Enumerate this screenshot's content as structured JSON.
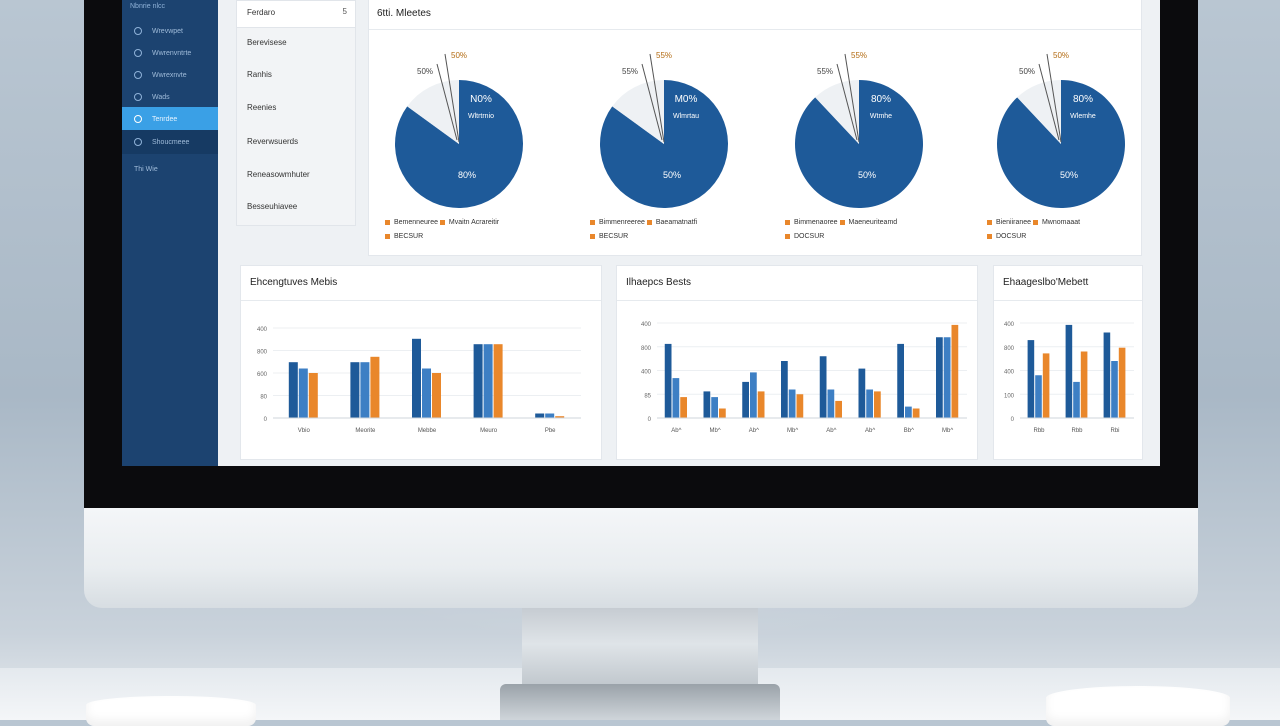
{
  "colors": {
    "blue": "#1e5a99",
    "orange": "#e9872b",
    "sidebar": "#1c4370",
    "active": "#3aa0e6",
    "light_slice": "#eef1f4"
  },
  "sidebar": {
    "top_label": "Nbnrie nlcc",
    "items": [
      {
        "label": "Wrevwpet",
        "icon": "circle-icon"
      },
      {
        "label": "Wwrenvntrte",
        "icon": "circle-icon"
      },
      {
        "label": "Wwrexnvte",
        "icon": "circle-icon"
      },
      {
        "label": "Wads",
        "icon": "circle-icon"
      },
      {
        "label": "Tenrdee",
        "icon": "circle-icon"
      },
      {
        "label": "Shoucmeee",
        "icon": "circle-icon"
      },
      {
        "label": "Thi Wie",
        "icon": "circle-icon"
      }
    ],
    "active_index": 4
  },
  "subnav": {
    "header": "Ferdaro",
    "header_mark": "5",
    "items": [
      "Berevisese",
      "Ranhis",
      "Reenies",
      "Reverwsuerds",
      "Reneasowmhuter",
      "Besseuhiavee"
    ]
  },
  "pie_panel": {
    "title": "6tti. Mleetes",
    "pies": [
      {
        "top_label": "50%",
        "side_label": "50%",
        "big_label": "N0%",
        "sub_label": "Wltrtrnio",
        "bottom_label": "80%",
        "legend1": "Bemenneuree",
        "legend1b": "Mvaitn Acrareitir",
        "legend2": "BECSUR"
      },
      {
        "top_label": "55%",
        "side_label": "55%",
        "big_label": "M0%",
        "sub_label": "Wlmrtau",
        "bottom_label": "50%",
        "legend1": "Bimmenreeree",
        "legend1b": "Baeamatnatfi",
        "legend2": "BECSUR"
      },
      {
        "top_label": "55%",
        "side_label": "55%",
        "big_label": "80%",
        "sub_label": "Wtmhe",
        "bottom_label": "50%",
        "legend1": "Bimmenaoree",
        "legend1b": "Maeneuriteamd",
        "legend2": "DOCSUR"
      },
      {
        "top_label": "50%",
        "side_label": "50%",
        "big_label": "80%",
        "sub_label": "Wlemhe",
        "bottom_label": "50%",
        "legend1": "Bieniiranee",
        "legend1b": "Mwnomaaat",
        "legend2": "DOCSUR"
      }
    ]
  },
  "bar_panels": [
    {
      "title": "Ehcengtuves Mebis"
    },
    {
      "title": "Ilhaepcs Bests"
    },
    {
      "title": "Ehaageslbo'Mebett"
    }
  ],
  "chart_data": [
    {
      "type": "pie",
      "title": "",
      "charts": [
        {
          "values": [
            85,
            15
          ],
          "labels": [
            "80%",
            "50%"
          ]
        },
        {
          "values": [
            85,
            15
          ],
          "labels": [
            "50%",
            "55%"
          ]
        },
        {
          "values": [
            88,
            12
          ],
          "labels": [
            "50%",
            "55%"
          ]
        },
        {
          "values": [
            88,
            12
          ],
          "labels": [
            "50%",
            "50%"
          ]
        }
      ]
    },
    {
      "type": "bar",
      "title": "Ehcengtuves Mebis",
      "yticks": [
        "400",
        "800",
        "600",
        "80",
        "0"
      ],
      "categories": [
        "Vbio",
        "Meorite",
        "Mebbe",
        "Meuro",
        "Pbe"
      ],
      "ylim": [
        0,
        100
      ],
      "series": [
        {
          "values": [
            62,
            62,
            88,
            82,
            5
          ]
        },
        {
          "values": [
            55,
            62,
            55,
            82,
            5
          ]
        },
        {
          "values": [
            50,
            68,
            50,
            82,
            2
          ]
        }
      ]
    },
    {
      "type": "bar",
      "title": "Ilhaepcs Bests",
      "yticks": [
        "400",
        "800",
        "400",
        "85",
        "0"
      ],
      "categories": [
        "Ab^",
        "Mb^",
        "Ab^",
        "Mb^",
        "Ab^",
        "Ab^",
        "Bb^",
        "Mb^"
      ],
      "ylim": [
        0,
        100
      ],
      "series": [
        {
          "values": [
            78,
            28,
            38,
            60,
            65,
            52,
            78,
            85
          ]
        },
        {
          "values": [
            42,
            22,
            48,
            30,
            30,
            30,
            12,
            85
          ]
        },
        {
          "values": [
            22,
            10,
            28,
            25,
            18,
            28,
            10,
            98
          ]
        }
      ]
    },
    {
      "type": "bar",
      "title": "Ehaageslbo'Mebett",
      "yticks": [
        "400",
        "800",
        "400",
        "100",
        "0"
      ],
      "categories": [
        "Rbb",
        "Rbb",
        "Rbi"
      ],
      "ylim": [
        0,
        100
      ],
      "series": [
        {
          "values": [
            82,
            98,
            90
          ]
        },
        {
          "values": [
            45,
            38,
            60
          ]
        },
        {
          "values": [
            68,
            70,
            74
          ]
        }
      ]
    }
  ]
}
